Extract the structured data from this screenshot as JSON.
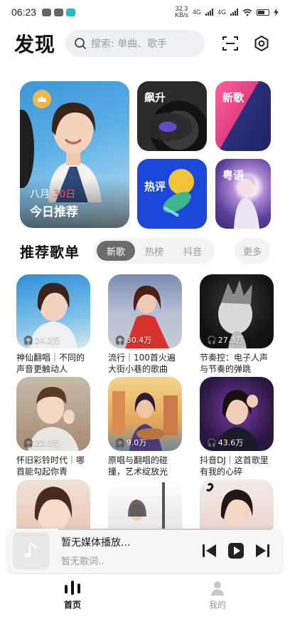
{
  "status": {
    "time": "06:23",
    "net_speed": "32.3\nKB/s",
    "net_labels": [
      "4G",
      "4G"
    ],
    "battery": "charging"
  },
  "header": {
    "title": "发现",
    "search_placeholder": "搜索: 单曲、歌手",
    "icons": [
      "search-icon",
      "scan-icon",
      "settings-icon"
    ]
  },
  "feature": {
    "month": "八月",
    "day": "30日",
    "label": "今日推荐",
    "badge_color": "#f0b84a"
  },
  "tiles": [
    {
      "label": "飙升"
    },
    {
      "label": "新歌"
    },
    {
      "label": "热评"
    },
    {
      "label": "粤语"
    }
  ],
  "section": {
    "title": "推荐歌单",
    "tabs": [
      "新歌",
      "热榜",
      "抖音"
    ],
    "active_tab": "新歌",
    "more": "更多"
  },
  "playlists": [
    {
      "plays": "24.2万",
      "name": "神仙翻唱｜不同的声音更触动人"
    },
    {
      "plays": "30.4万",
      "name": "流行｜100首火遍大街小巷的歌曲"
    },
    {
      "plays": "27.3万",
      "name": "节奏控：电子人声与节奏的弹跳"
    },
    {
      "plays": "22.3万",
      "name": "怀旧彩铃时代｜哪首能勾起你青"
    },
    {
      "plays": "9.0万",
      "name": "原唱与翻唱的碰撞，艺术绽放光"
    },
    {
      "plays": "43.6万",
      "name": "抖音DJ｜这首歌里有我的心碎"
    }
  ],
  "player": {
    "title": "暂无媒体播放...",
    "subtitle": "暂无歌词.."
  },
  "nav": [
    {
      "label": "首页",
      "active": true
    },
    {
      "label": "我的",
      "active": false
    }
  ],
  "colors": {
    "accent_red": "#ff4d4f",
    "tab_active": "#6c6c6c"
  }
}
